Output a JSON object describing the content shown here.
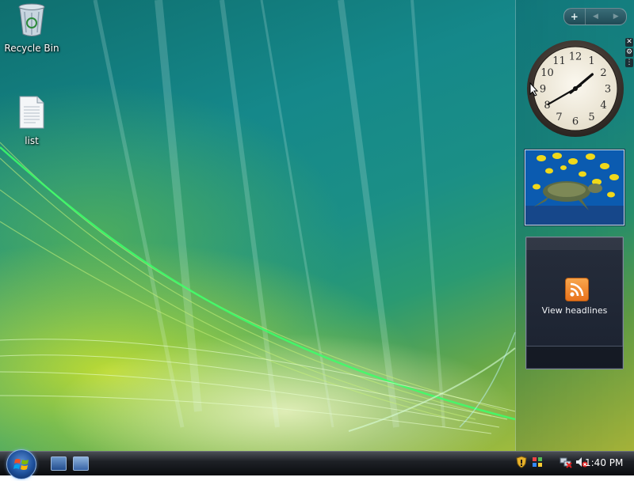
{
  "desktop": {
    "icons": [
      {
        "name": "recycle-bin",
        "label": "Recycle Bin",
        "icon": "recycle-bin-icon"
      },
      {
        "name": "list",
        "label": "list",
        "icon": "text-document-icon"
      }
    ]
  },
  "sidebar": {
    "controls": {
      "add": "+",
      "prev": "◀",
      "next": "▶"
    },
    "gadget_tools": [
      "close-icon",
      "wrench-icon",
      "grip-icon"
    ],
    "clock": {
      "numbers": [
        "12",
        "1",
        "2",
        "3",
        "4",
        "5",
        "6",
        "7",
        "8",
        "9",
        "10",
        "11"
      ],
      "hour": 1,
      "minute": 40
    },
    "slideshow": {
      "subject": "sea-turtle-photo"
    },
    "feeds": {
      "headline_label": "View headlines",
      "icon": "rss-feed-icon"
    }
  },
  "taskbar": {
    "start": "windows-start-orb",
    "quicklaunch": [
      "show-desktop-icon",
      "switch-windows-icon"
    ],
    "tray_icons": [
      "security-shield-icon",
      "windows-flag-icon",
      "network-disconnected-icon",
      "volume-muted-icon"
    ],
    "time": "1:40 PM"
  },
  "colors": {
    "accent": "#1b8f86",
    "taskbar": "#0a0c0f",
    "feed_orange": "#e8721b"
  }
}
